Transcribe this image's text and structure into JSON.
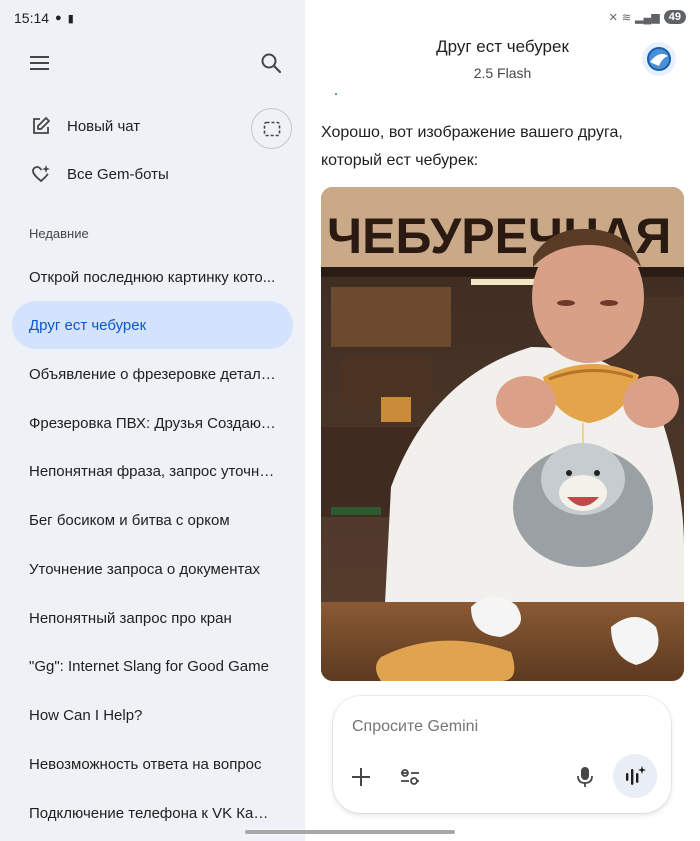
{
  "status": {
    "time": "15:14",
    "battery": "49"
  },
  "sidebar": {
    "new_chat_label": "Новый чат",
    "gems_label": "Все Gem-боты",
    "recent_heading": "Недавние",
    "recent": [
      {
        "label": "Открой последнюю картинку кото...",
        "active": false
      },
      {
        "label": "Друг ест чебурек",
        "active": true
      },
      {
        "label": "Объявление о фрезеровке деталей...",
        "active": false
      },
      {
        "label": "Фрезеровка ПВХ: Друзья Создают ...",
        "active": false
      },
      {
        "label": "Непонятная фраза, запрос уточне...",
        "active": false
      },
      {
        "label": "Бег босиком и битва с орком",
        "active": false
      },
      {
        "label": "Уточнение запроса о документах",
        "active": false
      },
      {
        "label": "Непонятный запрос про кран",
        "active": false
      },
      {
        "label": "\"Gg\": Internet Slang for Good Game",
        "active": false
      },
      {
        "label": "How Can I Help?",
        "active": false
      },
      {
        "label": "Невозможность ответа на вопрос",
        "active": false
      },
      {
        "label": "Подключение телефона к VK Капсу...",
        "active": false
      }
    ]
  },
  "chat": {
    "title": "Друг ест чебурек",
    "model": "2.5 Flash",
    "response_text": "Хорошо, вот изображение вашего друга, который ест чебурек:",
    "image_sign_text": "ЧЕБУРЕЧНАЯ"
  },
  "composer": {
    "placeholder": "Спросите Gemini"
  },
  "colors": {
    "sidebar_bg": "#eef1f6",
    "active_item_bg": "#d3e3fd",
    "active_item_text": "#0b57d0"
  }
}
